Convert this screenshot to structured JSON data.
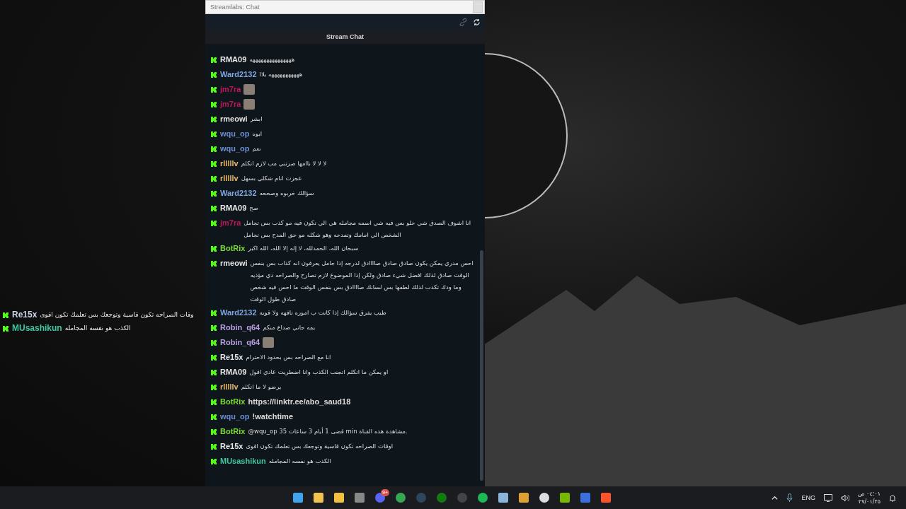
{
  "window": {
    "title": "Streamlabs: Chat"
  },
  "header": {
    "title": "Stream Chat"
  },
  "messages": [
    {
      "user": "RMA09",
      "color": "#e6e6e6",
      "kind": "text",
      "text": "هههههههههههههههه"
    },
    {
      "user": "Ward2132",
      "color": "#7fa6e0",
      "kind": "text",
      "text": "هههههههههههه بلاا"
    },
    {
      "user": "jm7ra",
      "color": "#c2185b",
      "kind": "emote"
    },
    {
      "user": "jm7ra",
      "color": "#c2185b",
      "kind": "emote"
    },
    {
      "user": "rmeowi",
      "color": "#e6e6e6",
      "kind": "text",
      "text": "ابشر"
    },
    {
      "user": "wqu_op",
      "color": "#6d8fd0",
      "kind": "text",
      "text": "ابوه"
    },
    {
      "user": "wqu_op",
      "color": "#6d8fd0",
      "kind": "text",
      "text": "نعم"
    },
    {
      "user": "rlllllv",
      "color": "#e8b866",
      "kind": "text",
      "text": "لا لا لا ناامها ضرتني مب لازم اتكلم"
    },
    {
      "user": "rlllllv",
      "color": "#e8b866",
      "kind": "text",
      "text": "عجزت انام شكلي بسهل"
    },
    {
      "user": "Ward2132",
      "color": "#7fa6e0",
      "kind": "text",
      "text": "سؤالك خربوه وصححه"
    },
    {
      "user": "RMA09",
      "color": "#e6e6e6",
      "kind": "text",
      "text": "صح"
    },
    {
      "user": "jm7ra",
      "color": "#c2185b",
      "kind": "text",
      "text": "انا اشوف الصدق شي حلو بس فيه شي اسمه مجامله هي الي تكون فيه مو كذب بس تجامل الشخص الي امامك وتمدحه وهو شكله مو حق المدح بس تجامل"
    },
    {
      "user": "BotRix",
      "color": "#7cd93a",
      "kind": "text",
      "text": "سبحان الله، الحمدلله، لا إله إلا الله، الله اكبر"
    },
    {
      "user": "rmeowi",
      "color": "#e6e6e6",
      "kind": "text",
      "text": "احس مدري يمكن يكون صادق صادق صاااادق لدرجه إذا جامل يعرفون انه كذاب بس بنفس الوقت صادق لذلك افضل شيء صادق ولكن إذا الموضوع لازم تصارح والصراحه ذي مؤذيه وما ودك تكذب لذلك لطفها بس لسانك صاااادق بس بنفس الوقت ما احس فيه شخص صادق طول الوقت"
    },
    {
      "user": "Ward2132",
      "color": "#7fa6e0",
      "kind": "text",
      "text": "طيب يفرق سؤالك إذا كانت ب اموره تافهه ولا قويه"
    },
    {
      "user": "Robin_q64",
      "color": "#b9a0e0",
      "kind": "text",
      "text": "يمه جاني صداع منكم"
    },
    {
      "user": "Robin_q64",
      "color": "#b9a0e0",
      "kind": "emote"
    },
    {
      "user": "Re15x",
      "color": "#e6e6e6",
      "kind": "text",
      "text": "انا مع الصراحه بس بحدود الاحترام"
    },
    {
      "user": "RMA09",
      "color": "#e6e6e6",
      "kind": "text",
      "text": "او يمكن ما اتكلم اتجنب الكذب وانا اضطريت عادي اقول"
    },
    {
      "user": "rlllllv",
      "color": "#e8b866",
      "kind": "text",
      "text": "يرضو لا ما اتكلم"
    },
    {
      "user": "BotRix",
      "color": "#7cd93a",
      "kind": "link",
      "text": "https://linktr.ee/abo_saud18"
    },
    {
      "user": "wqu_op",
      "color": "#6d8fd0",
      "kind": "command",
      "text": "!watchtime"
    },
    {
      "user": "BotRix",
      "color": "#7cd93a",
      "kind": "text",
      "text": "@wqu_op قضى 1 أيام 3 ساعات 35 min مشاهدة هذه القناة."
    },
    {
      "user": "Re15x",
      "color": "#e6e6e6",
      "kind": "text",
      "text": "اوقات الصراحه تكون قاسية وتوجعك بس تعلمك تكون اقوى"
    },
    {
      "user": "MUsashikun",
      "color": "#3ec7a0",
      "kind": "text",
      "text": "الكذب هو نفسه المجامله"
    }
  ],
  "overlay": [
    {
      "user": "Re15x",
      "color": "#c9d4e6",
      "text": "وقات الصراحه تكون قاسية وتوجعك بس تعلمك تكون اقوى"
    },
    {
      "user": "MUsashikun",
      "color": "#3ec7a0",
      "text": "الكذب هو نفسه المجامله"
    }
  ],
  "taskbar": {
    "apps": [
      {
        "kind": "windows"
      },
      {
        "kind": "store"
      },
      {
        "kind": "folder"
      },
      {
        "kind": "cube"
      },
      {
        "kind": "chat",
        "badge": "9+"
      },
      {
        "kind": "browser"
      },
      {
        "kind": "steam"
      },
      {
        "kind": "xbox"
      },
      {
        "kind": "record"
      },
      {
        "kind": "music"
      },
      {
        "kind": "letter"
      },
      {
        "kind": "game"
      },
      {
        "kind": "gear"
      },
      {
        "kind": "gpu"
      },
      {
        "kind": "capture"
      },
      {
        "kind": "lion"
      }
    ],
    "language": "ENG",
    "time": "٠٤:٠١ ص",
    "date": "٢٧/٠١/٢٥"
  }
}
